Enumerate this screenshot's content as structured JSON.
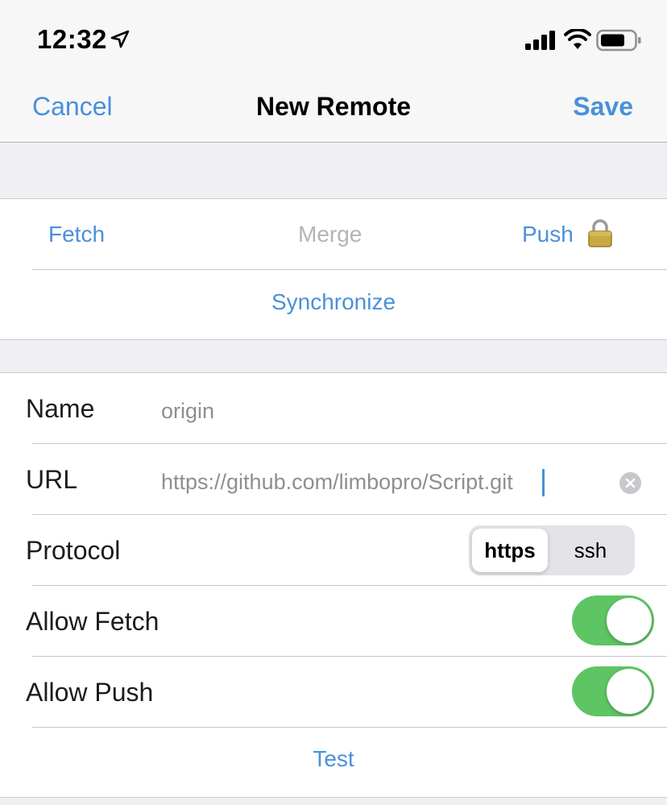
{
  "status_bar": {
    "time": "12:32",
    "icons": [
      "location-arrow-icon",
      "cellular-signal-icon",
      "wifi-icon",
      "battery-icon"
    ]
  },
  "nav": {
    "cancel_label": "Cancel",
    "title": "New Remote",
    "save_label": "Save"
  },
  "actions": {
    "fetch_label": "Fetch",
    "merge_label": "Merge",
    "push_label": "Push",
    "push_icon": "lock-icon",
    "synchronize_label": "Synchronize"
  },
  "form": {
    "name": {
      "label": "Name",
      "value": "origin"
    },
    "url": {
      "label": "URL",
      "value": "https://github.com/limbopro/Script.git"
    },
    "protocol": {
      "label": "Protocol",
      "options": [
        "https",
        "ssh"
      ],
      "selected": "https"
    },
    "allow_fetch": {
      "label": "Allow Fetch",
      "on": true
    },
    "allow_push": {
      "label": "Allow Push",
      "on": true
    },
    "test_label": "Test"
  },
  "colors": {
    "accent": "#4a90d9",
    "toggle_on": "#5fc463",
    "disabled": "#b4b4b4",
    "background": "#efeff4"
  }
}
